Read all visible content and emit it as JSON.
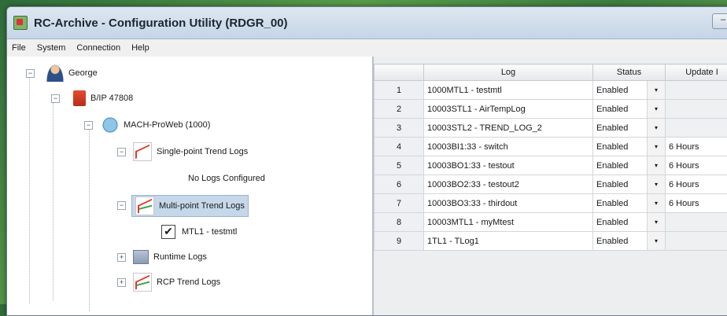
{
  "window": {
    "title": "RC-Archive - Configuration Utility (RDGR_00)",
    "minimize_glyph": "–"
  },
  "menu": [
    "File",
    "System",
    "Connection",
    "Help"
  ],
  "tree": {
    "root": "George",
    "device": "B/IP 47808",
    "controller": "MACH-ProWeb (1000)",
    "single_point": "Single-point Trend Logs",
    "no_logs": "No Logs Configured",
    "multi_point": "Multi-point Trend Logs",
    "mtl_item": "MTL1 - testmtl",
    "runtime": "Runtime Logs",
    "rcp": "RCP Trend Logs"
  },
  "table": {
    "headers": {
      "log": "Log",
      "status": "Status",
      "update": "Update I"
    },
    "rows": [
      {
        "num": "1",
        "log": "1000MTL1 - testmtl",
        "status": "Enabled",
        "update": ""
      },
      {
        "num": "2",
        "log": "10003STL1 - AirTempLog",
        "status": "Enabled",
        "update": ""
      },
      {
        "num": "3",
        "log": "10003STL2 - TREND_LOG_2",
        "status": "Enabled",
        "update": ""
      },
      {
        "num": "4",
        "log": "10003BI1:33 - switch",
        "status": "Enabled",
        "update": "6 Hours"
      },
      {
        "num": "5",
        "log": "10003BO1:33 - testout",
        "status": "Enabled",
        "update": "6 Hours"
      },
      {
        "num": "6",
        "log": "10003BO2:33 - testout2",
        "status": "Enabled",
        "update": "6 Hours"
      },
      {
        "num": "7",
        "log": "10003BO3:33 - thirdout",
        "status": "Enabled",
        "update": "6 Hours"
      },
      {
        "num": "8",
        "log": "10003MTL1 - myMtest",
        "status": "Enabled",
        "update": ""
      },
      {
        "num": "9",
        "log": "1TL1 - TLog1",
        "status": "Enabled",
        "update": ""
      }
    ]
  },
  "icons": {
    "dropdown": "▾",
    "expand": "+",
    "collapse": "−",
    "check": "✔"
  }
}
